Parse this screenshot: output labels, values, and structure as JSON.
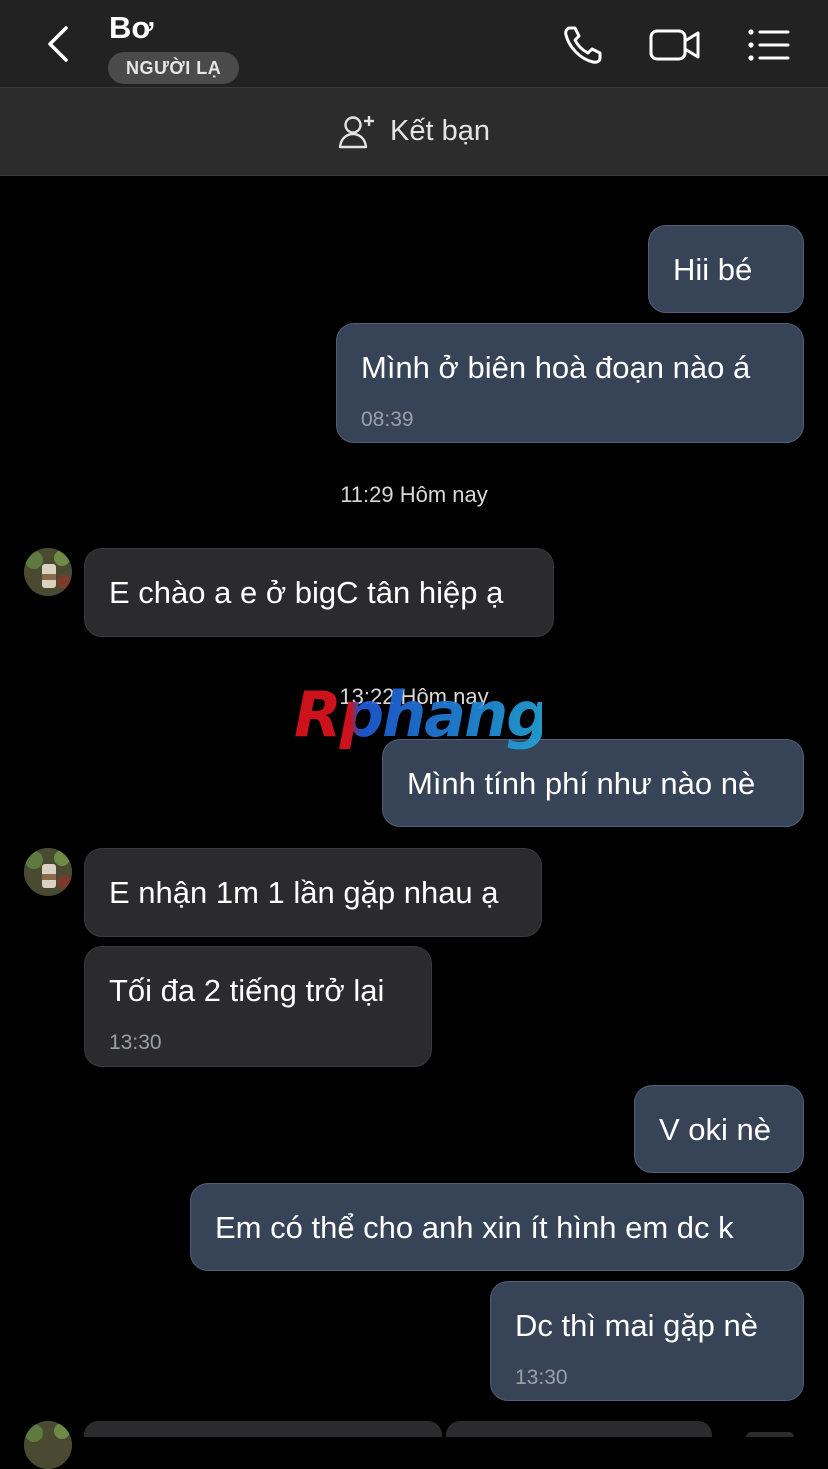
{
  "header": {
    "contact_name": "Bơ",
    "badge": "NGƯỜI LẠ"
  },
  "add_friend": {
    "label": "Kết bạn"
  },
  "messages": [
    {
      "from": "me",
      "text": "Hii bé"
    },
    {
      "from": "me",
      "text": "Mình ở biên hoà đoạn nào á",
      "time": "08:39"
    },
    {
      "type": "separator",
      "text": "11:29 Hôm nay"
    },
    {
      "from": "them",
      "text": "E chào a e ở bigC tân hiệp ạ"
    },
    {
      "type": "separator",
      "text": "13:22 Hôm nay"
    },
    {
      "from": "me",
      "text": "Mình tính phí như nào nè"
    },
    {
      "from": "them",
      "text": "E nhận 1m 1 lần gặp nhau ạ"
    },
    {
      "from": "them",
      "text": "Tối đa 2 tiếng trở lại",
      "time": "13:30"
    },
    {
      "from": "me",
      "text": "V oki nè"
    },
    {
      "from": "me",
      "text": "Em có thể cho anh xin ít hình em dc k"
    },
    {
      "from": "me",
      "text": "Dc thì mai gặp nè",
      "time": "13:30"
    }
  ],
  "watermark": {
    "text": "Rphang"
  },
  "colors": {
    "background": "#000000",
    "header": "#222222",
    "add_friend_bar": "#2c2c2c",
    "my_bubble": "#374357",
    "their_bubble": "#2b2b2d"
  },
  "icons": [
    "back-chevron-icon",
    "phone-icon",
    "video-camera-icon",
    "list-menu-icon",
    "add-person-icon"
  ]
}
